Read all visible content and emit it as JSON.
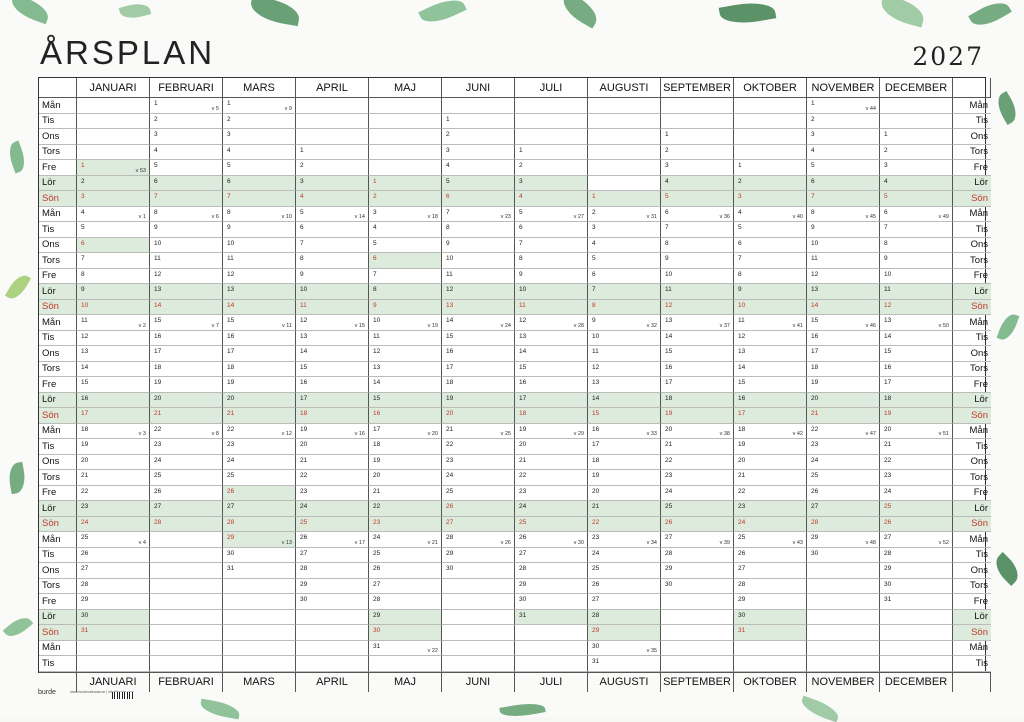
{
  "title": "ÅRSPLAN",
  "year": "2027",
  "brand": "burde",
  "footer_small": "www.burdecalendar.se | info@burde.com",
  "months": [
    "JANUARI",
    "FEBRUARI",
    "MARS",
    "APRIL",
    "MAJ",
    "JUNI",
    "JULI",
    "AUGUSTI",
    "SEPTEMBER",
    "OKTOBER",
    "NOVEMBER",
    "DECEMBER"
  ],
  "row_days": [
    "Mån",
    "Tis",
    "Ons",
    "Tors",
    "Fre",
    "Lör",
    "Sön",
    "Mån",
    "Tis",
    "Ons",
    "Tors",
    "Fre",
    "Lör",
    "Sön",
    "Mån",
    "Tis",
    "Ons",
    "Tors",
    "Fre",
    "Lör",
    "Sön",
    "Mån",
    "Tis",
    "Ons",
    "Tors",
    "Fre",
    "Lör",
    "Sön",
    "Mån",
    "Tis",
    "Ons",
    "Tors",
    "Fre",
    "Lör",
    "Sön",
    "Mån",
    "Tis"
  ],
  "month_start_row": [
    4,
    0,
    0,
    3,
    5,
    1,
    3,
    6,
    2,
    4,
    0,
    2
  ],
  "month_days": [
    31,
    28,
    31,
    30,
    31,
    30,
    31,
    31,
    30,
    31,
    30,
    31
  ],
  "week_start_month": [
    53,
    5,
    9,
    13,
    17,
    22,
    26,
    31,
    35,
    39,
    44,
    48
  ],
  "holidays": {
    "1-1": true,
    "1-6": true,
    "3-26": true,
    "3-29": true,
    "5-1": true,
    "5-6": true,
    "6-6": true,
    "6-26": true,
    "12-25": true,
    "12-26": true
  },
  "colors": {
    "weekend_bg": "#dcebdc",
    "sunday_text": "#c0392b",
    "leaf_green": "#5f9e6e"
  }
}
